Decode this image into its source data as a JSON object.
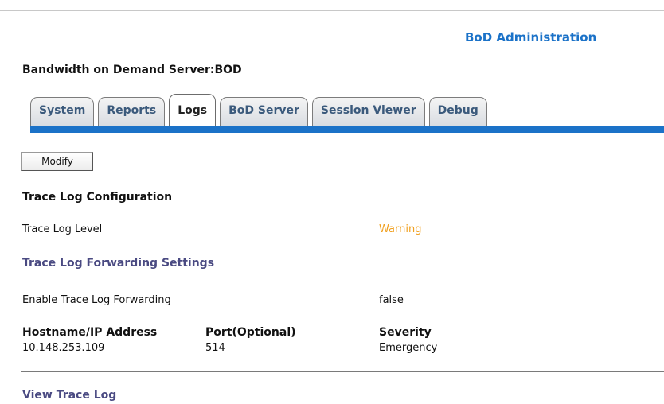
{
  "header": {
    "admin_title": "BoD Administration",
    "server_title": "Bandwidth on Demand Server:BOD"
  },
  "tabs": [
    {
      "label": "System",
      "active": false
    },
    {
      "label": "Reports",
      "active": false
    },
    {
      "label": "Logs",
      "active": true
    },
    {
      "label": "BoD Server",
      "active": false
    },
    {
      "label": "Session Viewer",
      "active": false
    },
    {
      "label": "Debug",
      "active": false
    }
  ],
  "toolbar": {
    "modify_label": "Modify"
  },
  "trace_config": {
    "title": "Trace Log Configuration",
    "level_label": "Trace Log Level",
    "level_value": "Warning"
  },
  "forwarding": {
    "title": "Trace Log Forwarding Settings",
    "enable_label": "Enable Trace Log Forwarding",
    "enable_value": "false",
    "columns": {
      "host": "Hostname/IP Address",
      "port": "Port(Optional)",
      "severity": "Severity"
    },
    "row": {
      "host": "10.148.253.109",
      "port": "514",
      "severity": "Emergency"
    }
  },
  "footer": {
    "view_link": "View Trace Log"
  },
  "colors": {
    "accent_blue": "#1b72c8",
    "warning": "#f0a020",
    "section_purple": "#4a4a82"
  }
}
